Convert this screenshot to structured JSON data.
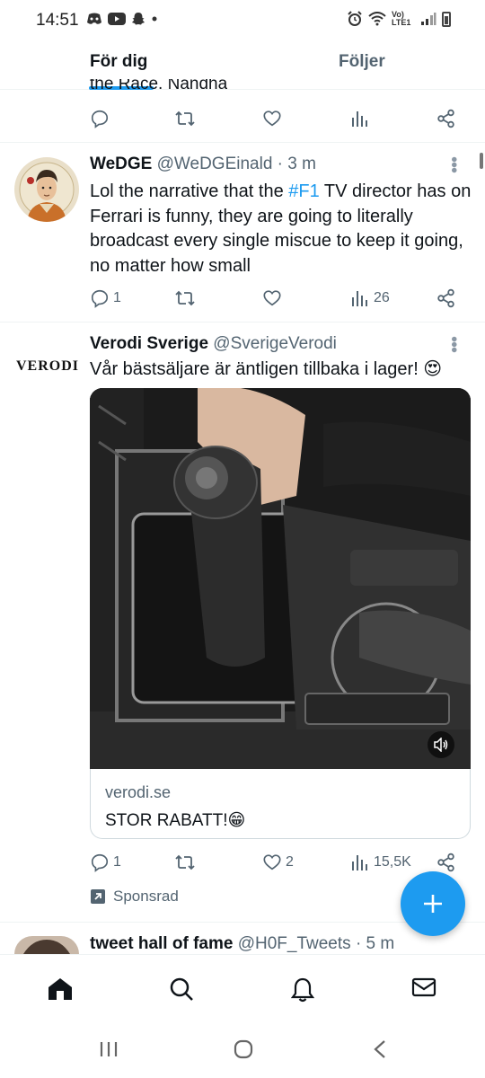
{
  "status_bar": {
    "time": "14:51",
    "network": "Vo) LTE1"
  },
  "tabs": {
    "for_you": "För dig",
    "following": "Följer"
  },
  "previous_tweet": {
    "clipped_text": "the Race.  Nandha"
  },
  "tweet1": {
    "name": "WeDGE",
    "handle": "@WeDGEinald",
    "time": "· 3 m",
    "text_before": "Lol the narrative that the ",
    "hashtag": "#F1",
    "text_after": " TV director has on Ferrari is funny, they are going to literally broadcast every single miscue to keep it going, no matter how small",
    "replies": "1",
    "views": "26"
  },
  "tweet2": {
    "logo_text": "VERODI",
    "name": "Verodi Sverige",
    "handle": "@SverigeVerodi",
    "text": "Vår bästsäljare är äntligen tillbaka i lager! 😍",
    "link_domain": "verodi.se",
    "link_title": "STOR RABATT!😁",
    "replies": "1",
    "likes": "2",
    "views": "15,5K",
    "sponsored": "Sponsrad"
  },
  "tweet3": {
    "name": "tweet hall of fame",
    "handle": "@H0F_Tweets",
    "time": "· 5 m"
  },
  "icons": {
    "accent": "#1d9bf0",
    "muted": "#536471"
  }
}
